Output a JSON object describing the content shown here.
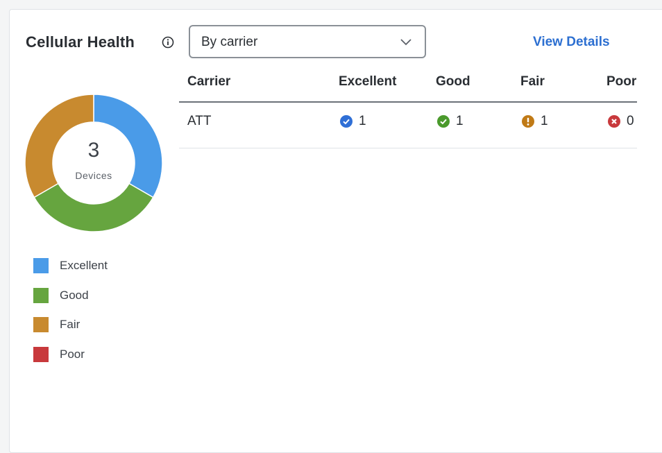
{
  "widget": {
    "title": "Cellular Health",
    "group_by": {
      "selected": "By carrier"
    },
    "view_details_label": "View Details"
  },
  "summary": {
    "count": "3",
    "label": "Devices",
    "segments": [
      {
        "status": "Excellent",
        "value": 1,
        "color": "#4a9be8"
      },
      {
        "status": "Good",
        "value": 1,
        "color": "#66a53f"
      },
      {
        "status": "Fair",
        "value": 1,
        "color": "#c88a2f"
      },
      {
        "status": "Poor",
        "value": 0,
        "color": "#c8393c"
      }
    ]
  },
  "legend": [
    {
      "label": "Excellent",
      "color": "#4a9be8"
    },
    {
      "label": "Good",
      "color": "#66a53f"
    },
    {
      "label": "Fair",
      "color": "#c88a2f"
    },
    {
      "label": "Poor",
      "color": "#c8393c"
    }
  ],
  "table": {
    "columns": [
      "Carrier",
      "Excellent",
      "Good",
      "Fair",
      "Poor"
    ],
    "rows": [
      {
        "carrier": "ATT",
        "excellent": "1",
        "good": "1",
        "fair": "1",
        "poor": "0"
      }
    ]
  },
  "icons": {
    "info": "info-circle-icon",
    "chevron": "chevron-down-icon",
    "excellent": "check-circle-icon",
    "good": "check-circle-icon",
    "fair": "exclamation-circle-icon",
    "poor": "x-circle-icon"
  }
}
